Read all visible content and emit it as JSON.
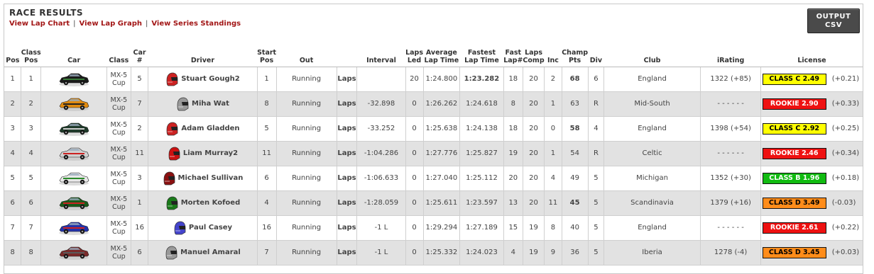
{
  "header": {
    "title": "RACE RESULTS",
    "links": [
      "View Lap Chart",
      "View Lap Graph",
      "View Series Standings"
    ],
    "csv_line1": "OUTPUT",
    "csv_line2": "CSV"
  },
  "columns": {
    "pos": "Pos",
    "class_pos": [
      "Class",
      "Pos"
    ],
    "car": "Car",
    "class": "Class",
    "car_num": "Car #",
    "driver": "Driver",
    "start_pos": [
      "Start",
      "Pos"
    ],
    "out": "Out",
    "interval": "Interval",
    "laps_led": [
      "Laps",
      "Led"
    ],
    "avg_lap": [
      "Average",
      "Lap Time"
    ],
    "fast_lap": [
      "Fastest",
      "Lap Time"
    ],
    "fast_lap_num": [
      "Fast",
      "Lap#"
    ],
    "laps_comp": [
      "Laps",
      "Comp"
    ],
    "inc": "Inc",
    "champ_pts": [
      "Champ",
      "Pts"
    ],
    "div": "Div",
    "club": "Club",
    "irating": "iRating",
    "license": "License"
  },
  "rows": [
    {
      "pos": "1",
      "class_pos": "1",
      "class": [
        "MX-5",
        "Cup"
      ],
      "car_num": "5",
      "driver": "Stuart Gough2",
      "start": "1",
      "out": "Running",
      "laps_link": "Laps",
      "interval": "",
      "laps_led": "20",
      "avg": "1:24.800",
      "fast": "1:23.282",
      "fast_num": "18",
      "comp": "20",
      "inc": "2",
      "pts": "68",
      "div": "6",
      "club": "England",
      "irating": "1322 (+85)",
      "license": "CLASS C 2.49",
      "license_color": "#ffff00",
      "license_text_color": "#000000",
      "lic_delta": "(+0.21)",
      "car_color": "#1a1a1a",
      "car_accent": "#3a7a3a",
      "helmet_color": "#cc2222",
      "fast_red": true,
      "pts_red": true
    },
    {
      "pos": "2",
      "class_pos": "2",
      "class": [
        "MX-5",
        "Cup"
      ],
      "car_num": "7",
      "driver": "Miha Wat",
      "start": "8",
      "out": "Running",
      "laps_link": "Laps",
      "interval": "-32.898",
      "laps_led": "0",
      "avg": "1:26.262",
      "fast": "1:24.618",
      "fast_num": "8",
      "comp": "20",
      "inc": "1",
      "pts": "63",
      "div": "R",
      "club": "Mid-South",
      "irating": "- - - - - -",
      "license": "ROOKIE 2.90",
      "license_color": "#ee1111",
      "license_text_color": "#ffffff",
      "lic_delta": "(+0.33)",
      "car_color": "#e08a10",
      "car_accent": "#222222",
      "helmet_color": "#999999",
      "fast_red": false,
      "pts_red": false
    },
    {
      "pos": "3",
      "class_pos": "3",
      "class": [
        "MX-5",
        "Cup"
      ],
      "car_num": "2",
      "driver": "Adam Gladden",
      "start": "5",
      "out": "Running",
      "laps_link": "Laps",
      "interval": "-33.252",
      "laps_led": "0",
      "avg": "1:25.638",
      "fast": "1:24.138",
      "fast_num": "18",
      "comp": "20",
      "inc": "0",
      "pts": "58",
      "div": "4",
      "club": "England",
      "irating": "1398 (+54)",
      "license": "CLASS C 2.92",
      "license_color": "#ffff00",
      "license_text_color": "#000000",
      "lic_delta": "(+0.25)",
      "car_color": "#1f3a2a",
      "car_accent": "#cccccc",
      "helmet_color": "#cc2222",
      "fast_red": false,
      "pts_red": true
    },
    {
      "pos": "4",
      "class_pos": "4",
      "class": [
        "MX-5",
        "Cup"
      ],
      "car_num": "11",
      "driver": "Liam Murray2",
      "start": "11",
      "out": "Running",
      "laps_link": "Laps",
      "interval": "-1:04.286",
      "laps_led": "0",
      "avg": "1:27.776",
      "fast": "1:25.827",
      "fast_num": "19",
      "comp": "20",
      "inc": "1",
      "pts": "54",
      "div": "R",
      "club": "Celtic",
      "irating": "- - - - - -",
      "license": "ROOKIE 2.46",
      "license_color": "#ee1111",
      "license_text_color": "#ffffff",
      "lic_delta": "(+0.34)",
      "car_color": "#d0d0d0",
      "car_accent": "#cc2222",
      "helmet_color": "#cc1111",
      "fast_red": false,
      "pts_red": false
    },
    {
      "pos": "5",
      "class_pos": "5",
      "class": [
        "MX-5",
        "Cup"
      ],
      "car_num": "3",
      "driver": "Michael Sullivan",
      "start": "6",
      "out": "Running",
      "laps_link": "Laps",
      "interval": "-1:06.633",
      "laps_led": "0",
      "avg": "1:27.040",
      "fast": "1:25.112",
      "fast_num": "20",
      "comp": "20",
      "inc": "4",
      "pts": "49",
      "div": "5",
      "club": "Michigan",
      "irating": "1352 (+30)",
      "license": "CLASS B 1.96",
      "license_color": "#11bb11",
      "license_text_color": "#ffffff",
      "lic_delta": "(+0.18)",
      "car_color": "#e8e8e8",
      "car_accent": "#2a8a2a",
      "helmet_color": "#8a1111",
      "fast_red": false,
      "pts_red": false
    },
    {
      "pos": "6",
      "class_pos": "6",
      "class": [
        "MX-5",
        "Cup"
      ],
      "car_num": "1",
      "driver": "Morten Kofoed",
      "start": "4",
      "out": "Running",
      "laps_link": "Laps",
      "interval": "-1:28.059",
      "laps_led": "0",
      "avg": "1:25.611",
      "fast": "1:23.597",
      "fast_num": "13",
      "comp": "20",
      "inc": "11",
      "pts": "45",
      "div": "5",
      "club": "Scandinavia",
      "irating": "1379 (+16)",
      "license": "CLASS D 3.49",
      "license_color": "#ff8c1a",
      "license_text_color": "#000000",
      "lic_delta": "(-0.03)",
      "car_color": "#1a5a1a",
      "car_accent": "#cc2222",
      "helmet_color": "#1a7a1a",
      "fast_red": false,
      "pts_red": true
    },
    {
      "pos": "7",
      "class_pos": "7",
      "class": [
        "MX-5",
        "Cup"
      ],
      "car_num": "16",
      "driver": "Paul Casey",
      "start": "16",
      "out": "Running",
      "laps_link": "Laps",
      "interval": "-1 L",
      "laps_led": "0",
      "avg": "1:29.294",
      "fast": "1:27.189",
      "fast_num": "15",
      "comp": "19",
      "inc": "8",
      "pts": "40",
      "div": "5",
      "club": "England",
      "irating": "- - - - - -",
      "license": "ROOKIE 2.61",
      "license_color": "#ee1111",
      "license_text_color": "#ffffff",
      "lic_delta": "(+0.22)",
      "car_color": "#2233aa",
      "car_accent": "#cc2222",
      "helmet_color": "#4444cc",
      "fast_red": false,
      "pts_red": false
    },
    {
      "pos": "8",
      "class_pos": "8",
      "class": [
        "MX-5",
        "Cup"
      ],
      "car_num": "6",
      "driver": "Manuel Amaral",
      "start": "7",
      "out": "Running",
      "laps_link": "Laps",
      "interval": "-1 L",
      "laps_led": "0",
      "avg": "1:25.332",
      "fast": "1:24.023",
      "fast_num": "4",
      "comp": "19",
      "inc": "9",
      "pts": "36",
      "div": "5",
      "club": "Iberia",
      "irating": "1278 (-4)",
      "license": "CLASS D 3.45",
      "license_color": "#ff8c1a",
      "license_text_color": "#000000",
      "lic_delta": "(+0.03)",
      "car_color": "#7a2a2a",
      "car_accent": "#5a5a5a",
      "helmet_color": "#999999",
      "fast_red": false,
      "pts_red": false
    }
  ]
}
